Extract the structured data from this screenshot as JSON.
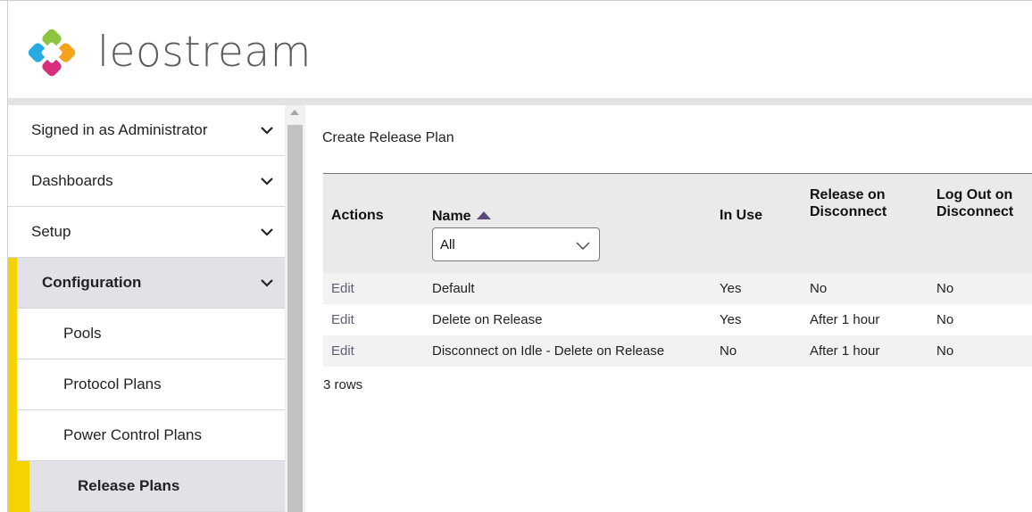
{
  "brand": {
    "name": "leostream",
    "colors": {
      "yellow": "#f3d300",
      "sort_arrow": "#5a4a78"
    }
  },
  "sidebar": {
    "items": [
      {
        "label": "Signed in as Administrator",
        "icon": "chevron-down-icon"
      },
      {
        "label": "Dashboards",
        "icon": "chevron-down-icon"
      },
      {
        "label": "Setup",
        "icon": "chevron-down-icon"
      },
      {
        "label": "Configuration",
        "icon": "chevron-down-icon"
      },
      {
        "label": "Pools"
      },
      {
        "label": "Protocol Plans"
      },
      {
        "label": "Power Control Plans"
      },
      {
        "label": "Release Plans"
      }
    ]
  },
  "main": {
    "create_link": "Create Release Plan",
    "table": {
      "headers": {
        "actions": "Actions",
        "name": "Name",
        "in_use": "In Use",
        "release_line1": "Release on",
        "release_line2": "Disconnect",
        "logout_line1": "Log Out on",
        "logout_line2": "Disconnect"
      },
      "filter": {
        "selected": "All"
      },
      "rows": [
        {
          "action": "Edit",
          "name": "Default",
          "in_use": "Yes",
          "release": "No",
          "logout": "No"
        },
        {
          "action": "Edit",
          "name": "Delete on Release",
          "in_use": "Yes",
          "release": "After 1 hour",
          "logout": "No"
        },
        {
          "action": "Edit",
          "name": "Disconnect on Idle - Delete on Release",
          "in_use": "No",
          "release": "After 1 hour",
          "logout": "No"
        }
      ],
      "row_count": "3 rows"
    }
  }
}
